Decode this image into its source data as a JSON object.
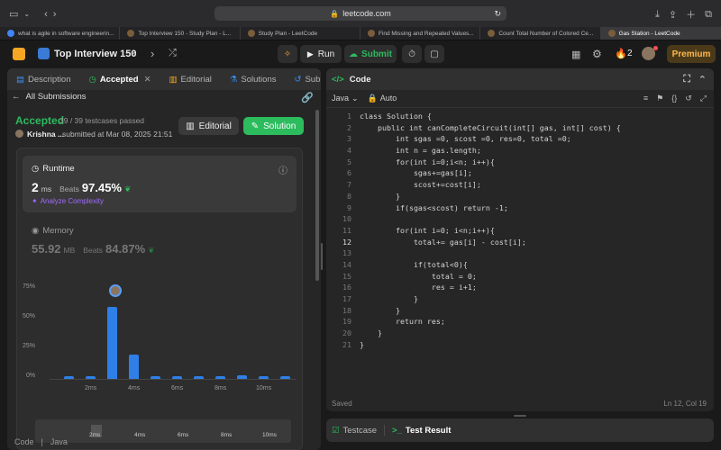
{
  "browser": {
    "url": "leetcode.com",
    "tabs": [
      {
        "label": "what is agile in software engineerin..."
      },
      {
        "label": "Top Interview 150 - Study Plan - L..."
      },
      {
        "label": "Study Plan - LeetCode"
      },
      {
        "label": "Find Missing and Repeated Values..."
      },
      {
        "label": "Count Total Number of Colored Ce..."
      },
      {
        "label": "Gas Station - LeetCode"
      }
    ]
  },
  "header": {
    "title": "Top Interview 150",
    "run_label": "Run",
    "submit_label": "Submit",
    "streak": "2",
    "premium_label": "Premium"
  },
  "left": {
    "tabs": [
      {
        "label": "Description"
      },
      {
        "label": "Accepted"
      },
      {
        "label": "Editorial"
      },
      {
        "label": "Solutions"
      },
      {
        "label": "Submissions"
      }
    ],
    "back_label": "All Submissions",
    "status": "Accepted",
    "testcases": "39 / 39 testcases passed",
    "user": "Krishna ...",
    "submitted": "submitted at Mar 08, 2025 21:51",
    "editorial_btn": "Editorial",
    "solution_btn": "Solution",
    "runtime_title": "Runtime",
    "runtime_value": "2",
    "runtime_unit": "ms",
    "beats_label": "Beats",
    "runtime_beats": "97.45%",
    "analyze_label": "Analyze Complexity",
    "memory_title": "Memory",
    "memory_value": "55.92",
    "memory_unit": "MB",
    "memory_beats": "84.87%",
    "bottom_label": "Code",
    "bottom_lang": "Java"
  },
  "chart_data": {
    "type": "bar",
    "ylabels": [
      "75%",
      "50%",
      "25%",
      "0%"
    ],
    "xlabels": [
      "2ms",
      "4ms",
      "6ms",
      "8ms",
      "10ms"
    ],
    "ylim": [
      0,
      0.75
    ],
    "values": [
      0.02,
      0.02,
      0.6,
      0.2,
      0.02,
      0.02,
      0.02,
      0.02,
      0.03,
      0.02,
      0.02
    ]
  },
  "right": {
    "title": "Code",
    "language": "Java",
    "mode": "Auto",
    "saved": "Saved",
    "cursor": "Ln 12, Col 19",
    "testcase_tab": "Testcase",
    "result_tab": "Test Result"
  },
  "code": [
    "class Solution {",
    "    public int canCompleteCircuit(int[] gas, int[] cost) {",
    "        int sgas =0, scost =0, res=0, total =0;",
    "        int n = gas.length;",
    "        for(int i=0;i<n; i++){",
    "            sgas+=gas[i];",
    "            scost+=cost[i];",
    "        }",
    "        if(sgas<scost) return -1;",
    "",
    "        for(int i=0; i<n;i++){",
    "            total+= gas[i] - cost[i];",
    "",
    "            if(total<0){",
    "                total = 0;",
    "                res = i+1;",
    "            }",
    "        }",
    "        return res;",
    "    }",
    "}"
  ]
}
